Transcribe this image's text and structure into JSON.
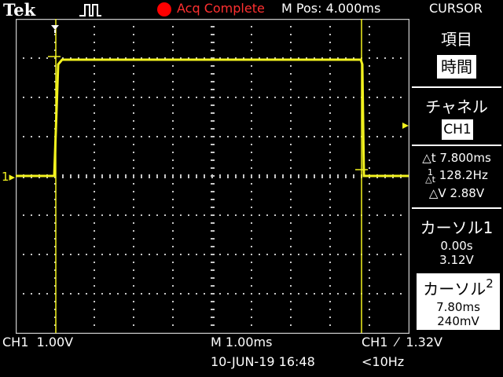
{
  "header": {
    "brand": "Tek",
    "acq_status": "Acq Complete",
    "m_pos": "M Pos: 4.000ms",
    "menu": "CURSOR"
  },
  "side": {
    "item_label": "項目",
    "item_value": "時間",
    "channel_label": "チャネル",
    "channel_value": "CH1",
    "delta_t": "7.800ms",
    "inv_delta_t": "128.2Hz",
    "delta_v": "2.88V",
    "cursor1_label": "カーソル1",
    "cursor1_time": "0.00s",
    "cursor1_volt": "3.12V",
    "cursor2_label": "カーソル",
    "cursor2_num": "2",
    "cursor2_time": "7.80ms",
    "cursor2_volt": "240mV"
  },
  "footer": {
    "ch1_scale": "CH1  1.00V",
    "timebase": "M 1.00ms",
    "datetime": "10-JUN-19 16:48",
    "trigger": "CH1  ⁄  1.32V",
    "freq": "<10Hz"
  },
  "trace": {
    "channel_marker": "1",
    "high_level_v": 3.12,
    "low_level_v": 0.24,
    "rise_time_ms": 0.0,
    "fall_time_ms": 7.8
  },
  "colors": {
    "trace": "#f2f21e",
    "acq_dot": "#ff0000",
    "acq_text": "#ff3030",
    "grid": "#c8c8c8",
    "text": "#ffffff"
  }
}
